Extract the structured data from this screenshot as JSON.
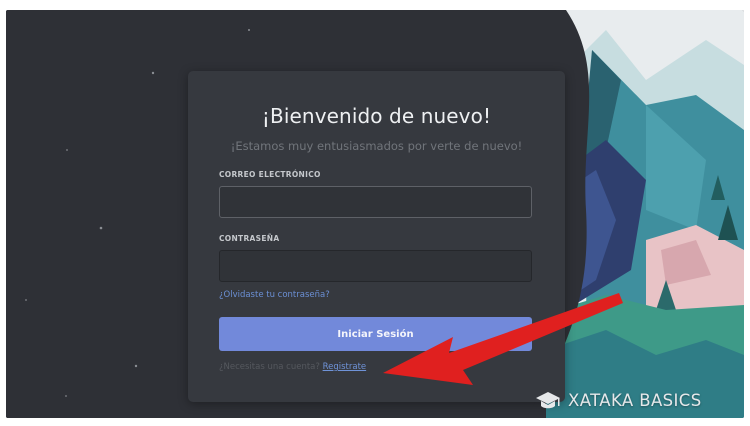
{
  "login": {
    "title": "¡Bienvenido de nuevo!",
    "subtitle": "¡Estamos muy entusiasmados por verte de nuevo!",
    "email_label": "CORREO ELECTRÓNICO",
    "email_value": "",
    "password_label": "CONTRASEÑA",
    "password_value": "",
    "forgot_password": "¿Olvidaste tu contraseña?",
    "submit_label": "Iniciar Sesión",
    "register_prompt": "¿Necesitas una cuenta?",
    "register_link": "Registrate"
  },
  "watermark": {
    "text": "XATAKA BASICS",
    "icon": "graduation-cap-icon"
  },
  "colors": {
    "background": "#2e3036",
    "card": "#36393f",
    "input": "#303338",
    "accent": "#7289da",
    "link": "#6b8fd4",
    "arrow": "#e0201f"
  }
}
